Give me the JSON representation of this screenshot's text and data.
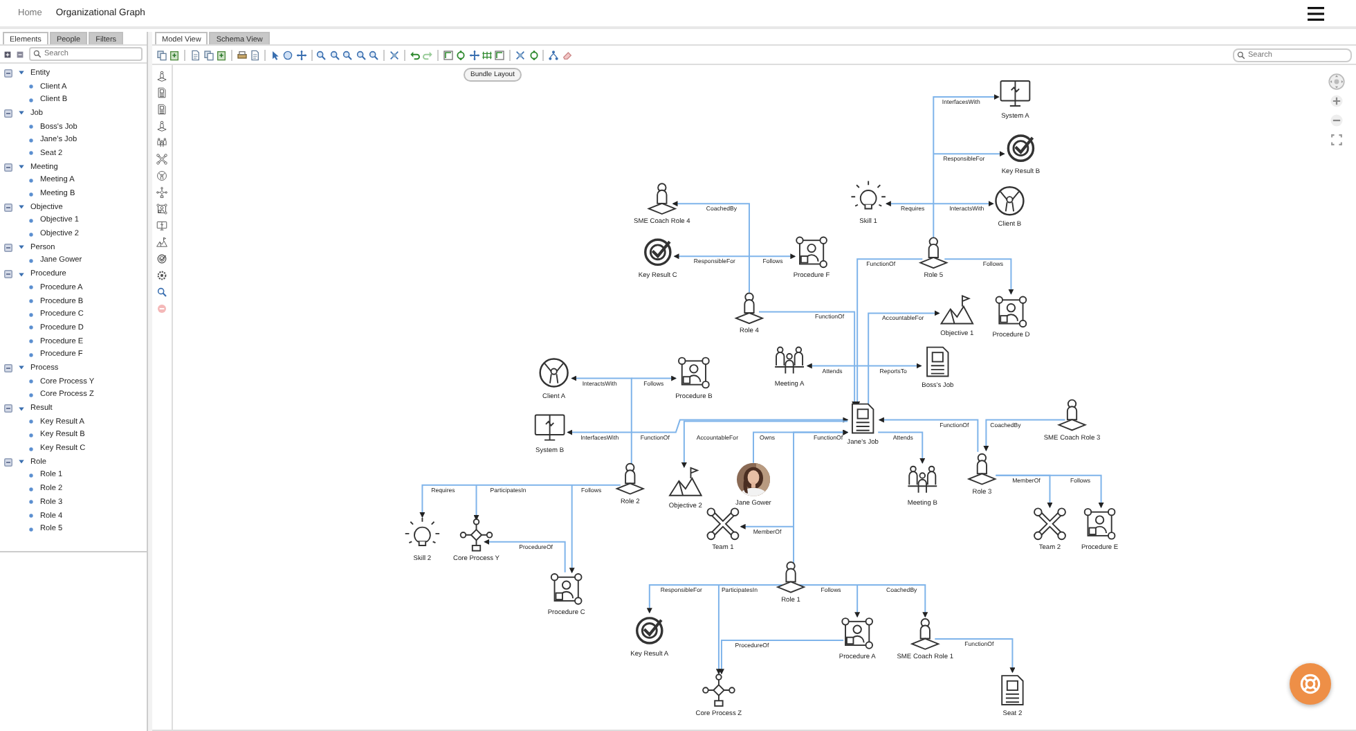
{
  "header": {
    "home": "Home",
    "title": "Organizational Graph"
  },
  "left_tabs": [
    {
      "label": "Elements",
      "selected": true
    },
    {
      "label": "People",
      "selected": false
    },
    {
      "label": "Filters",
      "selected": false
    }
  ],
  "tree_search": {
    "placeholder": "Search"
  },
  "tree": [
    {
      "label": "Entity",
      "expanded": true,
      "children": [
        {
          "label": "Client A"
        },
        {
          "label": "Client B"
        }
      ]
    },
    {
      "label": "Job",
      "expanded": true,
      "children": [
        {
          "label": "Boss's Job"
        },
        {
          "label": "Jane's Job"
        },
        {
          "label": "Seat 2"
        }
      ]
    },
    {
      "label": "Meeting",
      "expanded": true,
      "children": [
        {
          "label": "Meeting A"
        },
        {
          "label": "Meeting B"
        }
      ]
    },
    {
      "label": "Objective",
      "expanded": true,
      "children": [
        {
          "label": "Objective 1"
        },
        {
          "label": "Objective 2"
        }
      ]
    },
    {
      "label": "Person",
      "expanded": true,
      "children": [
        {
          "label": "Jane Gower"
        }
      ]
    },
    {
      "label": "Procedure",
      "expanded": true,
      "children": [
        {
          "label": "Procedure A"
        },
        {
          "label": "Procedure B"
        },
        {
          "label": "Procedure C"
        },
        {
          "label": "Procedure D"
        },
        {
          "label": "Procedure E"
        },
        {
          "label": "Procedure F"
        }
      ]
    },
    {
      "label": "Process",
      "expanded": true,
      "children": [
        {
          "label": "Core Process Y"
        },
        {
          "label": "Core Process Z"
        }
      ]
    },
    {
      "label": "Result",
      "expanded": true,
      "children": [
        {
          "label": "Key Result A"
        },
        {
          "label": "Key Result B"
        },
        {
          "label": "Key Result C"
        }
      ]
    },
    {
      "label": "Role",
      "expanded": true,
      "children": [
        {
          "label": "Role 1"
        },
        {
          "label": "Role 2"
        },
        {
          "label": "Role 3"
        },
        {
          "label": "Role 4"
        },
        {
          "label": "Role 5"
        }
      ]
    }
  ],
  "view_tabs": [
    {
      "label": "Model View",
      "selected": true
    },
    {
      "label": "Schema View",
      "selected": false
    }
  ],
  "tooltip": "Bundle Layout",
  "graph_search": {
    "placeholder": "Search"
  },
  "nodes": [
    {
      "kind": "system",
      "label": "System A"
    },
    {
      "kind": "result",
      "label": "Key Result B"
    },
    {
      "kind": "role",
      "label": "SME Coach Role 4"
    },
    {
      "kind": "skill",
      "label": "Skill 1"
    },
    {
      "kind": "client",
      "label": "Client B"
    },
    {
      "kind": "result",
      "label": "Key Result C"
    },
    {
      "kind": "procedure",
      "label": "Procedure F"
    },
    {
      "kind": "role",
      "label": "Role 5"
    },
    {
      "kind": "objective",
      "label": "Objective 1"
    },
    {
      "kind": "procedure",
      "label": "Procedure D"
    },
    {
      "kind": "role",
      "label": "Role 4"
    },
    {
      "kind": "meeting",
      "label": "Meeting A"
    },
    {
      "kind": "job",
      "label": "Boss's Job"
    },
    {
      "kind": "client",
      "label": "Client A"
    },
    {
      "kind": "procedure",
      "label": "Procedure B"
    },
    {
      "kind": "job",
      "label": "Jane's Job"
    },
    {
      "kind": "system",
      "label": "System B"
    },
    {
      "kind": "role",
      "label": "SME Coach Role 3"
    },
    {
      "kind": "role",
      "label": "Role 3"
    },
    {
      "kind": "role",
      "label": "Role 2"
    },
    {
      "kind": "objective",
      "label": "Objective 2"
    },
    {
      "label": "Jane Gower"
    },
    {
      "kind": "meeting",
      "label": "Meeting B"
    },
    {
      "kind": "team",
      "label": "Team 1"
    },
    {
      "kind": "skill",
      "label": "Skill 2"
    },
    {
      "kind": "process",
      "label": "Core Process Y"
    },
    {
      "kind": "team",
      "label": "Team 2"
    },
    {
      "kind": "procedure",
      "label": "Procedure E"
    },
    {
      "kind": "role",
      "label": "Role 1"
    },
    {
      "kind": "procedure",
      "label": "Procedure C"
    },
    {
      "kind": "result",
      "label": "Key Result A"
    },
    {
      "kind": "procedure",
      "label": "Procedure A"
    },
    {
      "kind": "role",
      "label": "SME Coach Role 1"
    },
    {
      "kind": "process",
      "label": "Core Process Z"
    },
    {
      "kind": "job",
      "label": "Seat 2"
    }
  ],
  "edges": [
    {
      "label": "InterfacesWith"
    },
    {
      "label": "ResponsibleFor"
    },
    {
      "label": "Requires"
    },
    {
      "label": "InteractsWith"
    },
    {
      "label": "FunctionOf"
    },
    {
      "label": "Follows"
    },
    {
      "label": "CoachedBy"
    },
    {
      "label": "ResponsibleFor"
    },
    {
      "label": "Follows"
    },
    {
      "label": "FunctionOf"
    },
    {
      "label": "AccountableFor"
    },
    {
      "label": "Attends"
    },
    {
      "label": "ReportsTo"
    },
    {
      "label": "InteractsWith"
    },
    {
      "label": "Follows"
    },
    {
      "label": "InterfacesWith"
    },
    {
      "label": "FunctionOf"
    },
    {
      "label": "AccountableFor"
    },
    {
      "label": "Owns"
    },
    {
      "label": "FunctionOf"
    },
    {
      "label": "MemberOf"
    },
    {
      "label": "Attends"
    },
    {
      "label": "FunctionOf"
    },
    {
      "label": "CoachedBy"
    },
    {
      "label": "MemberOf"
    },
    {
      "label": "Follows"
    },
    {
      "label": "Requires"
    },
    {
      "label": "ParticipatesIn"
    },
    {
      "label": "Follows"
    },
    {
      "label": "ProcedureOf"
    },
    {
      "label": "ResponsibleFor"
    },
    {
      "label": "ParticipatesIn"
    },
    {
      "label": "Follows"
    },
    {
      "label": "CoachedBy"
    },
    {
      "label": "ProcedureOf"
    },
    {
      "label": "FunctionOf"
    }
  ]
}
